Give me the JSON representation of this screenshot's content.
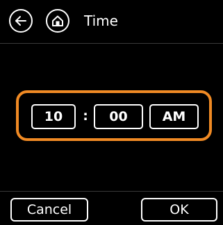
{
  "header": {
    "title": "Time",
    "back_icon": "arrow-left-icon",
    "home_icon": "home-icon"
  },
  "time_picker": {
    "hour": "10",
    "separator": ":",
    "minute": "00",
    "period": "AM",
    "focus_color": "#f08a24"
  },
  "footer": {
    "cancel_label": "Cancel",
    "ok_label": "OK"
  },
  "colors": {
    "background": "#000000",
    "foreground": "#ffffff",
    "accent": "#f08a24"
  }
}
